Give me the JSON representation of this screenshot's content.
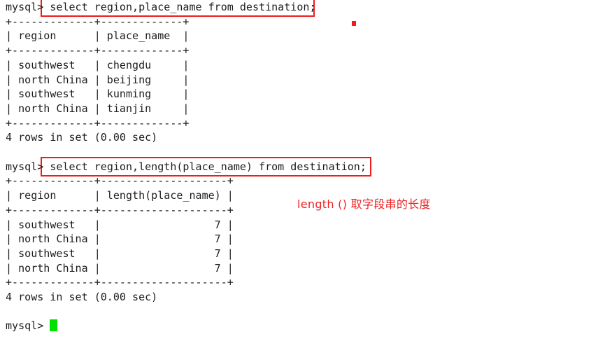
{
  "terminal": {
    "prompt": "mysql> ",
    "lines": [
      {
        "id": "l01",
        "type": "prompt",
        "text": "select region,place_name from destination;"
      },
      {
        "id": "l02",
        "type": "separator",
        "text": "+-------------+-------------+"
      },
      {
        "id": "l03",
        "type": "header",
        "text": "| region      | place_name  |"
      },
      {
        "id": "l04",
        "type": "separator",
        "text": "+-------------+-------------+"
      },
      {
        "id": "l05",
        "type": "row",
        "text": "| southwest   | chengdu     |"
      },
      {
        "id": "l06",
        "type": "row",
        "text": "| north China | beijing     |"
      },
      {
        "id": "l07",
        "type": "row",
        "text": "| southwest   | kunming     |"
      },
      {
        "id": "l08",
        "type": "row",
        "text": "| north China | tianjin     |"
      },
      {
        "id": "l09",
        "type": "separator",
        "text": "+-------------+-------------+"
      },
      {
        "id": "l10",
        "type": "status",
        "text": "4 rows in set (0.00 sec)"
      },
      {
        "id": "l11",
        "type": "blank",
        "text": ""
      },
      {
        "id": "l12",
        "type": "prompt",
        "text": "select region,length(place_name) from destination;"
      },
      {
        "id": "l13",
        "type": "separator",
        "text": "+-------------+--------------------+"
      },
      {
        "id": "l14",
        "type": "header",
        "text": "| region      | length(place_name) |"
      },
      {
        "id": "l15",
        "type": "separator",
        "text": "+-------------+--------------------+"
      },
      {
        "id": "l16",
        "type": "row",
        "text": "| southwest   |                  7 |"
      },
      {
        "id": "l17",
        "type": "row",
        "text": "| north China |                  7 |"
      },
      {
        "id": "l18",
        "type": "row",
        "text": "| southwest   |                  7 |"
      },
      {
        "id": "l19",
        "type": "row",
        "text": "| north China |                  7 |"
      },
      {
        "id": "l20",
        "type": "separator",
        "text": "+-------------+--------------------+"
      },
      {
        "id": "l21",
        "type": "status",
        "text": "4 rows in set (0.00 sec)"
      },
      {
        "id": "l22",
        "type": "blank",
        "text": ""
      },
      {
        "id": "l23",
        "type": "cursor",
        "text": ""
      }
    ],
    "queries": [
      {
        "name": "query-select-region-place-name",
        "sql": "select region,place_name from destination;",
        "result": {
          "columns": [
            "region",
            "place_name"
          ],
          "rows": [
            [
              "southwest",
              "chengdu"
            ],
            [
              "north China",
              "beijing"
            ],
            [
              "southwest",
              "kunming"
            ],
            [
              "north China",
              "tianjin"
            ]
          ],
          "status": "4 rows in set (0.00 sec)"
        }
      },
      {
        "name": "query-select-region-length",
        "sql": "select region,length(place_name) from destination;",
        "result": {
          "columns": [
            "region",
            "length(place_name)"
          ],
          "rows": [
            [
              "southwest",
              "7"
            ],
            [
              "north China",
              "7"
            ],
            [
              "southwest",
              "7"
            ],
            [
              "north China",
              "7"
            ]
          ],
          "status": "4 rows in set (0.00 sec)"
        }
      }
    ]
  },
  "annotations": {
    "length_note": "length () 取字段串的长度"
  },
  "colors": {
    "highlight_red": "#ee1c1c",
    "annotation_red": "#ee2222",
    "cursor_green": "#00e000",
    "text": "#1c1c1c",
    "background": "#ffffff"
  }
}
